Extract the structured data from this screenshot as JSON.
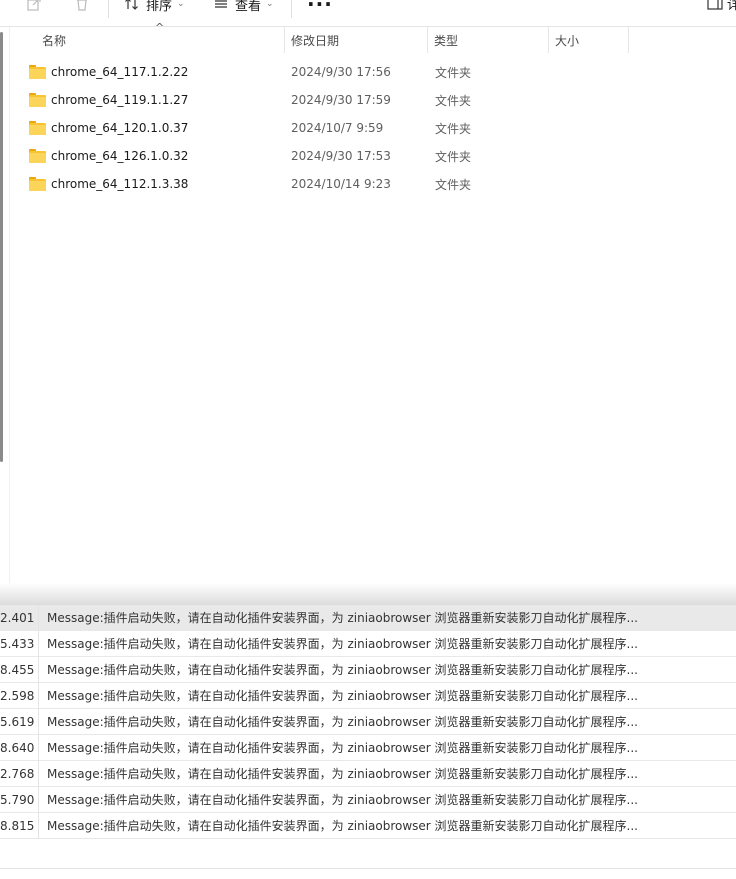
{
  "toolbar": {
    "sort_label": "排序",
    "view_label": "查看",
    "more_label": "···",
    "right_text": "详"
  },
  "columns": {
    "name": "名称",
    "date": "修改日期",
    "type": "类型",
    "size": "大小"
  },
  "files": [
    {
      "name": "chrome_64_117.1.2.22",
      "date": "2024/9/30 17:56",
      "type": "文件夹"
    },
    {
      "name": "chrome_64_119.1.1.27",
      "date": "2024/9/30 17:59",
      "type": "文件夹"
    },
    {
      "name": "chrome_64_120.1.0.37",
      "date": "2024/10/7 9:59",
      "type": "文件夹"
    },
    {
      "name": "chrome_64_126.1.0.32",
      "date": "2024/9/30 17:53",
      "type": "文件夹"
    },
    {
      "name": "chrome_64_112.1.3.38",
      "date": "2024/10/14 9:23",
      "type": "文件夹"
    }
  ],
  "logs": [
    {
      "time": "2.401",
      "message": "Message:插件启动失败，请在自动化插件安装界面，为 ziniaobrowser 浏览器重新安装影刀自动化扩展程序..."
    },
    {
      "time": "5.433",
      "message": "Message:插件启动失败，请在自动化插件安装界面，为 ziniaobrowser 浏览器重新安装影刀自动化扩展程序..."
    },
    {
      "time": "8.455",
      "message": "Message:插件启动失败，请在自动化插件安装界面，为 ziniaobrowser 浏览器重新安装影刀自动化扩展程序..."
    },
    {
      "time": "2.598",
      "message": "Message:插件启动失败，请在自动化插件安装界面，为 ziniaobrowser 浏览器重新安装影刀自动化扩展程序..."
    },
    {
      "time": "5.619",
      "message": "Message:插件启动失败，请在自动化插件安装界面，为 ziniaobrowser 浏览器重新安装影刀自动化扩展程序..."
    },
    {
      "time": "8.640",
      "message": "Message:插件启动失败，请在自动化插件安装界面，为 ziniaobrowser 浏览器重新安装影刀自动化扩展程序..."
    },
    {
      "time": "2.768",
      "message": "Message:插件启动失败，请在自动化插件安装界面，为 ziniaobrowser 浏览器重新安装影刀自动化扩展程序..."
    },
    {
      "time": "5.790",
      "message": "Message:插件启动失败，请在自动化插件安装界面，为 ziniaobrowser 浏览器重新安装影刀自动化扩展程序..."
    },
    {
      "time": "8.815",
      "message": "Message:插件启动失败，请在自动化插件安装界面，为 ziniaobrowser 浏览器重新安装影刀自动化扩展程序..."
    }
  ]
}
